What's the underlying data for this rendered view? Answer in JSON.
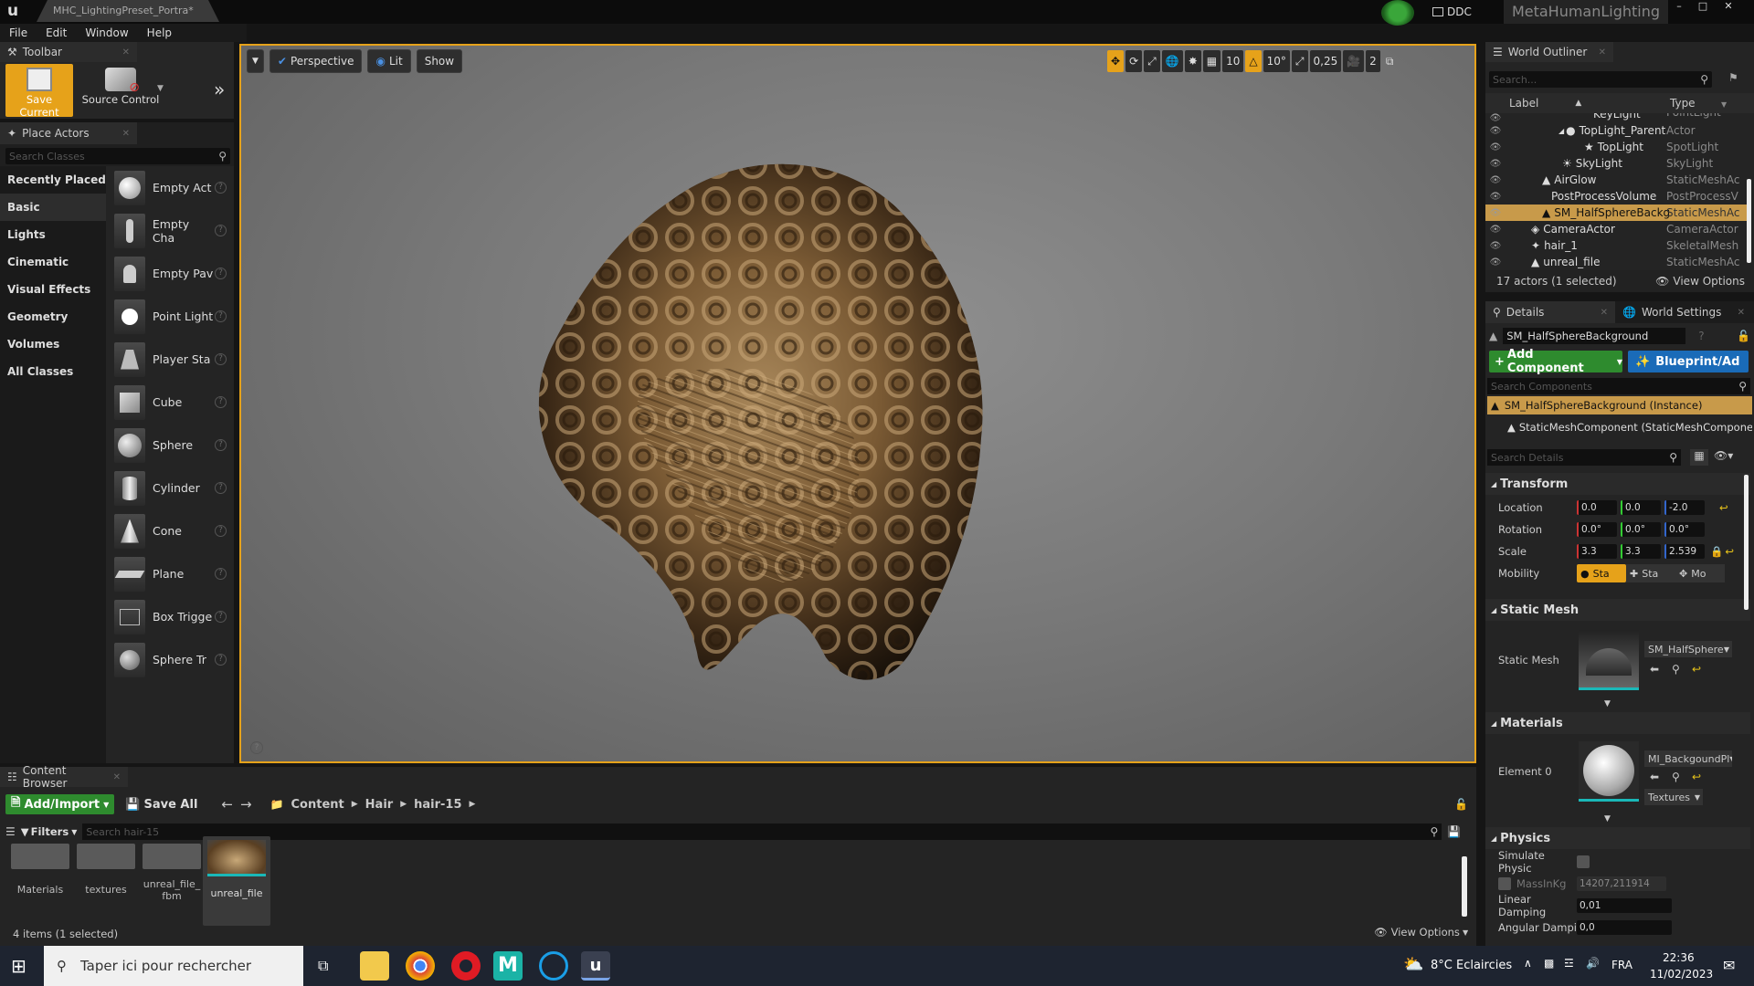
{
  "app": {
    "doc_tab": "MHC_LightingPreset_Portra*",
    "ddc": "DDC",
    "project": "MetaHumanLighting",
    "minimize": "–",
    "maximize": "□",
    "close": "✕"
  },
  "menu": [
    "File",
    "Edit",
    "Window",
    "Help"
  ],
  "toolbar": {
    "tab": "Toolbar",
    "save_current": "Save Current",
    "source_control": "Source Control",
    "more": "»"
  },
  "place_actors": {
    "tab": "Place Actors",
    "search_placeholder": "Search Classes",
    "categories": [
      "Recently Placed",
      "Basic",
      "Lights",
      "Cinematic",
      "Visual Effects",
      "Geometry",
      "Volumes",
      "All Classes"
    ],
    "active_category": "Basic",
    "items": [
      "Empty Act",
      "Empty Cha",
      "Empty Pav",
      "Point Light",
      "Player Sta",
      "Cube",
      "Sphere",
      "Cylinder",
      "Cone",
      "Plane",
      "Box Trigge",
      "Sphere Tr"
    ]
  },
  "viewport": {
    "perspective": "Perspective",
    "lit": "Lit",
    "show": "Show",
    "grid_snap": "10",
    "rot_snap": "10°",
    "scale_snap": "0,25",
    "cam_speed": "2"
  },
  "outliner": {
    "tab": "World Outliner",
    "search_placeholder": "Search...",
    "col_label": "Label",
    "col_type": "Type",
    "rows": [
      {
        "label": "KeyLight",
        "type": "PointLight",
        "indent": 6
      },
      {
        "label": "TopLight_Parent",
        "type": "Actor",
        "indent": 4
      },
      {
        "label": "TopLight",
        "type": "SpotLight",
        "indent": 5
      },
      {
        "label": "SkyLight",
        "type": "SkyLight",
        "indent": 3
      },
      {
        "label": "AirGlow",
        "type": "StaticMeshAc",
        "indent": 2
      },
      {
        "label": "PostProcessVolume",
        "type": "PostProcessV",
        "indent": 2
      },
      {
        "label": "SM_HalfSphereBackg",
        "type": "StaticMeshAc",
        "indent": 2,
        "selected": true
      },
      {
        "label": "CameraActor",
        "type": "CameraActor",
        "indent": 1
      },
      {
        "label": "hair_1",
        "type": "SkeletalMesh",
        "indent": 1
      },
      {
        "label": "unreal_file",
        "type": "StaticMeshAc",
        "indent": 1
      }
    ],
    "status": "17 actors (1 selected)",
    "view_options": "View Options"
  },
  "details": {
    "tab": "Details",
    "world_settings": "World Settings",
    "actor_name": "SM_HalfSphereBackground",
    "add_component": "Add Component",
    "blueprint": "Blueprint/Ad",
    "search_components": "Search Components",
    "instance_row": "SM_HalfSphereBackground (Instance)",
    "component_row": "StaticMeshComponent (StaticMeshComponent",
    "search_details": "Search Details",
    "transform": "Transform",
    "location": "Location",
    "rotation": "Rotation",
    "scale": "Scale",
    "mobility": "Mobility",
    "loc": [
      "0.0",
      "0.0",
      "-2.0"
    ],
    "rot": [
      "0.0°",
      "0.0°",
      "0.0°"
    ],
    "scl": [
      "3.3",
      "3.3",
      "2.539"
    ],
    "mob": [
      "Sta",
      "Sta",
      "Mo"
    ],
    "static_mesh_section": "Static Mesh",
    "static_mesh_label": "Static Mesh",
    "static_mesh_value": "SM_HalfSphere",
    "materials": "Materials",
    "element0": "Element 0",
    "material_value": "MI_BackgoundPl",
    "textures": "Textures",
    "physics": "Physics",
    "simulate": "Simulate Physic",
    "mass": "MassInKg",
    "mass_value": "14207,211914",
    "linear": "Linear Damping",
    "linear_value": "0,01",
    "angular": "Angular Dampin",
    "angular_value": "0,0"
  },
  "content_browser": {
    "tab": "Content Browser",
    "add_import": "Add/Import",
    "save_all": "Save All",
    "path": [
      "Content",
      "Hair",
      "hair-15"
    ],
    "filters": "Filters",
    "search_placeholder": "Search hair-15",
    "items": [
      "Materials",
      "textures",
      "unreal_file_\nfbm",
      "unreal_file"
    ],
    "status": "4 items (1 selected)",
    "view_options": "View Options"
  },
  "taskbar": {
    "search": "Taper ici pour rechercher",
    "weather": "8°C  Eclaircies",
    "lang": "FRA",
    "time": "22:36",
    "date": "11/02/2023"
  },
  "colors": {
    "accent": "#e6a21a",
    "selected": "#c89a4a",
    "green": "#2e8b2e",
    "blue": "#1a6bb8"
  }
}
